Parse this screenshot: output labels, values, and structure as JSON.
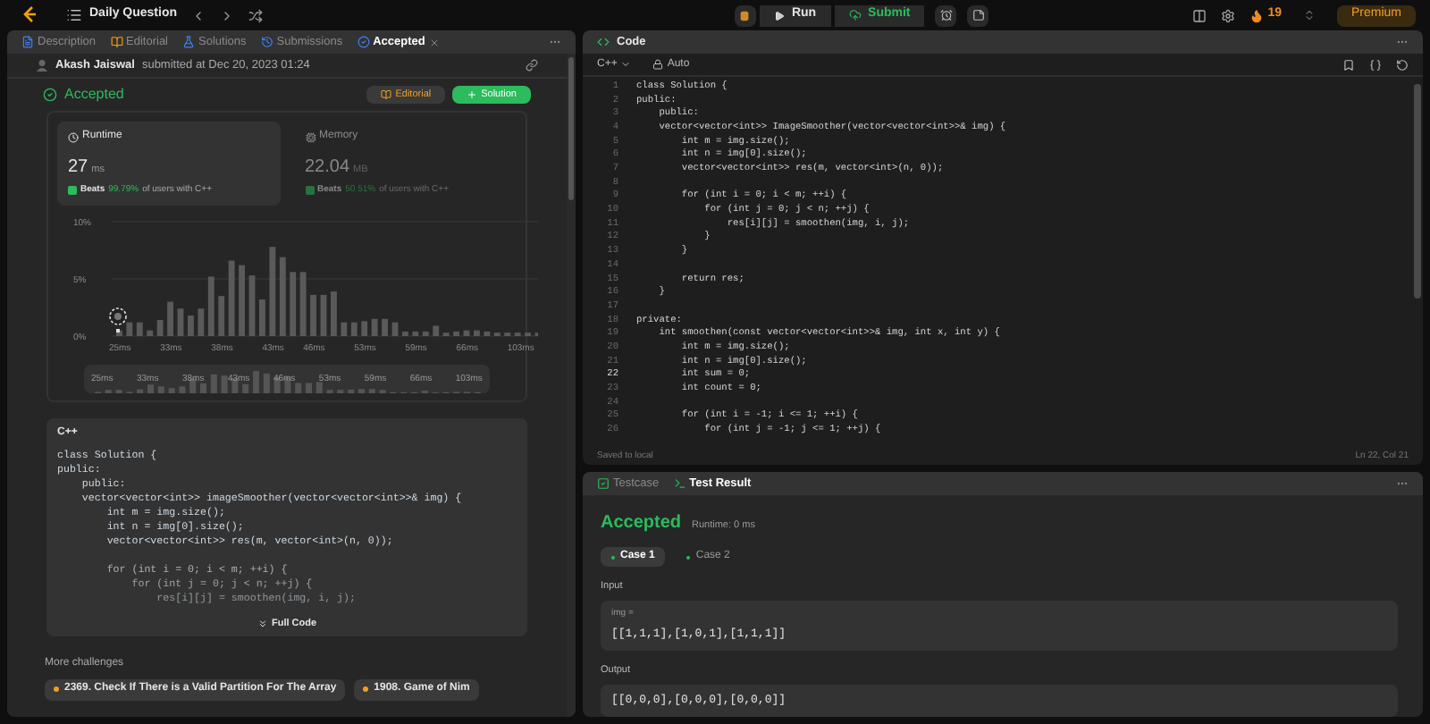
{
  "top_bar": {
    "title": "Daily Question",
    "run": "Run",
    "submit": "Submit",
    "streak": "19",
    "premium": "Premium"
  },
  "left_tabs": [
    {
      "label": "Description",
      "selected": false
    },
    {
      "label": "Editorial",
      "selected": false
    },
    {
      "label": "Solutions",
      "selected": false
    },
    {
      "label": "Submissions",
      "selected": false
    },
    {
      "label": "Accepted",
      "selected": true,
      "closable": true
    }
  ],
  "submission": {
    "author": "Akash Jaiswal",
    "submitted": "submitted at Dec 20, 2023 01:24",
    "status": "Accepted",
    "editorial_button": "Editorial",
    "solution_button": "Solution"
  },
  "stats": [
    {
      "label": "Runtime",
      "value": "27",
      "unit": "ms",
      "beats": "Beats",
      "percent": "99.79%",
      "suffix": "of users with C++",
      "selected": true
    },
    {
      "label": "Memory",
      "value": "22.04",
      "unit": "MB",
      "beats": "Beats",
      "percent": "50.51%",
      "suffix": "of users with C++",
      "selected": false
    }
  ],
  "chart_data": {
    "type": "bar",
    "ylim": [
      0,
      10
    ],
    "yticks": [
      {
        "value": 10,
        "label": "10%"
      },
      {
        "value": 5,
        "label": "5%"
      },
      {
        "value": 0,
        "label": "0%"
      }
    ],
    "categories": [
      "25ms",
      null,
      null,
      null,
      null,
      "33ms",
      null,
      null,
      null,
      null,
      "38ms",
      null,
      null,
      null,
      null,
      "43ms",
      null,
      null,
      null,
      "46ms",
      null,
      null,
      null,
      null,
      "53ms",
      null,
      null,
      null,
      null,
      "59ms",
      null,
      null,
      null,
      null,
      "66ms",
      null,
      null,
      null,
      null,
      "103ms",
      null,
      null
    ],
    "values": [
      0.5,
      1.2,
      1.2,
      0.5,
      1.4,
      3.0,
      2.4,
      1.8,
      2.4,
      5.2,
      3.5,
      6.6,
      6.2,
      5.3,
      3.2,
      7.8,
      6.9,
      5.6,
      5.6,
      3.6,
      3.6,
      3.9,
      1.2,
      1.2,
      1.3,
      1.5,
      1.5,
      1.2,
      0.4,
      0.4,
      0.4,
      0.9,
      0.3,
      0.4,
      0.5,
      0.5,
      0.4,
      0.3,
      0.3,
      0.3,
      0.3,
      0.3
    ]
  },
  "overview_labels": [
    "25ms",
    "33ms",
    "38ms",
    "43ms",
    "46ms",
    "53ms",
    "59ms",
    "66ms",
    "103ms"
  ],
  "code_card": {
    "language": "C++",
    "button": "Full Code",
    "lines": [
      [
        "class Solution {",
        "public:",
        "    public:",
        "    vector<vector<int>> imageSmoother(vector<vector<int>>& img) {",
        "        int m = img.size();",
        "        int n = img[0].size();",
        "        vector<vector<int>> res(m, vector<int>(n, 0));"
      ],
      [
        "        for (int i = 0; i < m; ++i) {",
        "            for (int j = 0; j < n; ++j) {",
        "                res[i][j] = smoothen(img, i, j);"
      ]
    ]
  },
  "more_challenges": {
    "title": "More challenges",
    "items": [
      "2369. Check If There is a Valid Partition For The Array",
      "1908. Game of Nim"
    ]
  },
  "editor": {
    "title": "Code",
    "language": "C++",
    "mode": "Auto",
    "saved": "Saved to local",
    "position": "Ln 22, Col 21",
    "lines": [
      {
        "number": "1",
        "text": "class Solution {",
        "current": false
      },
      {
        "number": "2",
        "text": "public:",
        "current": false
      },
      {
        "number": "3",
        "text": "    public:",
        "current": false
      },
      {
        "number": "4",
        "text": "    vector<vector<int>> ImageSmoother(vector<vector<int>>& img) {",
        "current": false
      },
      {
        "number": "5",
        "text": "        int m = img.size();",
        "current": false
      },
      {
        "number": "6",
        "text": "        int n = img[0].size();",
        "current": false
      },
      {
        "number": "7",
        "text": "        vector<vector<int>> res(m, vector<int>(n, 0));",
        "current": false
      },
      {
        "number": "8",
        "current": false
      },
      {
        "number": "9",
        "text": "        for (int i = 0; i < m; ++i) {",
        "current": false
      },
      {
        "number": "10",
        "text": "            for (int j = 0; j < n; ++j) {",
        "current": false
      },
      {
        "number": "11",
        "text": "                res[i][j] = smoothen(img, i, j);",
        "current": false
      },
      {
        "number": "12",
        "text": "            }",
        "current": false
      },
      {
        "number": "13",
        "text": "        }",
        "current": false
      },
      {
        "number": "14",
        "current": false
      },
      {
        "number": "15",
        "text": "        return res;",
        "current": false
      },
      {
        "number": "16",
        "text": "    }",
        "current": false
      },
      {
        "number": "17",
        "current": false
      },
      {
        "number": "18",
        "text": "private:",
        "current": false
      },
      {
        "number": "19",
        "text": "    int smoothen(const vector<vector<int>>& img, int x, int y) {",
        "current": false
      },
      {
        "number": "20",
        "text": "        int m = img.size();",
        "current": false
      },
      {
        "number": "21",
        "text": "        int n = img[0].size();",
        "current": false
      },
      {
        "number": "22",
        "text": "        int sum = 0;",
        "current": true
      },
      {
        "number": "23",
        "text": "        int count = 0;",
        "current": false
      },
      {
        "number": "24",
        "current": false
      },
      {
        "number": "25",
        "text": "        for (int i = -1; i <= 1; ++i) {",
        "current": false
      },
      {
        "number": "26",
        "text": "            for (int j = -1; j <= 1; ++j) {",
        "current": false
      }
    ]
  },
  "result_tabs": [
    {
      "label": "Testcase",
      "selected": false
    },
    {
      "label": "Test Result",
      "selected": true
    }
  ],
  "result": {
    "status": "Accepted",
    "runtime": "Runtime: 0 ms",
    "cases": [
      {
        "label": "Case 1",
        "selected": true
      },
      {
        "label": "Case 2",
        "selected": false
      }
    ],
    "input_label": "Input",
    "input_name": "img =",
    "input_value": "[[1,1,1],[1,0,1],[1,1,1]]",
    "output_label": "Output",
    "output_value": "[[0,0,0],[0,0,0],[0,0,0]]"
  }
}
